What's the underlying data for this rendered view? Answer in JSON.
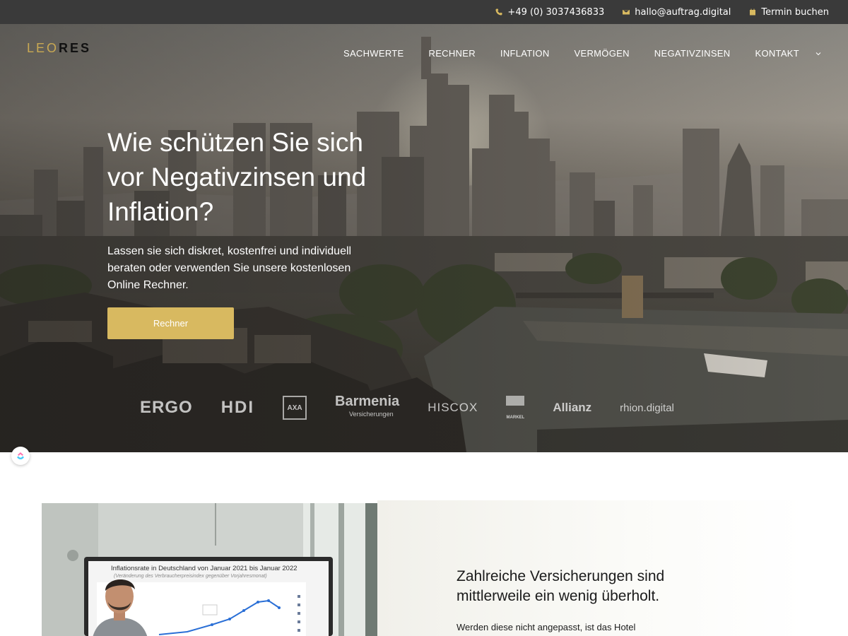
{
  "topbar": {
    "phone": "+49 (0) 3037436833",
    "email": "hallo@auftrag.digital",
    "booking": "Termin buchen",
    "accent_color": "#d8b960"
  },
  "logo": {
    "part1": "LEO",
    "part2": "RES"
  },
  "nav": {
    "items": [
      "SACHWERTE",
      "RECHNER",
      "INFLATION",
      "VERMÖGEN",
      "NEGATIVZINSEN",
      "KONTAKT"
    ]
  },
  "hero": {
    "title": "Wie schützen Sie sich vor Negativzinsen und Inflation?",
    "subtitle": "Lassen sie sich diskret, kostenfrei und individuell beraten oder verwenden Sie unsere kostenlosen Online Rechner.",
    "button_label": "Rechner",
    "button_color": "#d8b960"
  },
  "partners": {
    "ergo": "ERGO",
    "hdi": "HDI",
    "axa": "AXA",
    "barmenia": "Barmenia",
    "barmenia_sub": "Versicherungen",
    "hiscox": "HISCOX",
    "markel": "MARKEL",
    "allianz": "Allianz",
    "rhion": "rhion.digital"
  },
  "feature": {
    "screen_title": "Inflationsrate in Deutschland von Januar 2021 bis Januar 2022",
    "screen_subtitle": "(Veränderung des Verbraucherpreisindex gegenüber Vorjahresmonat)",
    "title": "Zahlreiche Versicherungen sind mittlerweile ein wenig überholt.",
    "text": "Werden diese nicht angepasst, ist das Hotel"
  }
}
